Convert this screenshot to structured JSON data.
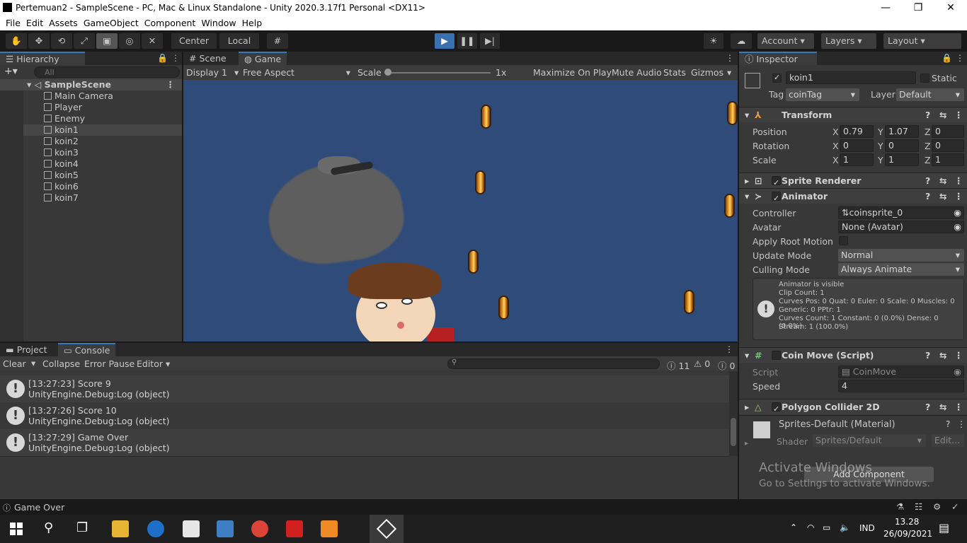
{
  "window": {
    "title": "Pertemuan2 - SampleScene - PC, Mac & Linux Standalone - Unity 2020.3.17f1 Personal <DX11>",
    "minimize": "—",
    "maximize": "❐",
    "close": "✕"
  },
  "menu": [
    "File",
    "Edit",
    "Assets",
    "GameObject",
    "Component",
    "Window",
    "Help"
  ],
  "toolbar": {
    "center_label": "Center",
    "local_label": "Local",
    "account_label": "Account",
    "layers_label": "Layers",
    "layout_label": "Layout"
  },
  "hierarchy": {
    "tab_label": "Hierarchy",
    "search_placeholder": "All",
    "scene_name": "SampleScene",
    "items": [
      "Main Camera",
      "Player",
      "Enemy",
      "koin1",
      "koin2",
      "koin3",
      "koin4",
      "koin5",
      "koin6",
      "koin7"
    ]
  },
  "game": {
    "tabs": [
      "Scene",
      "Game"
    ],
    "display": "Display 1",
    "aspect": "Free Aspect",
    "scale_label": "Scale",
    "scale_value": "1x",
    "maximize_on_play": "Maximize On Play",
    "mute_audio": "Mute Audio",
    "stats": "Stats",
    "gizmos": "Gizmos"
  },
  "console": {
    "tabs": [
      "Project",
      "Console"
    ],
    "clear": "Clear",
    "collapse": "Collapse",
    "error_pause": "Error Pause",
    "editor": "Editor",
    "count_log": "11",
    "count_warn": "0",
    "count_error": "0",
    "entries": [
      {
        "line1": "[13:27:23] Score 9",
        "line2": "UnityEngine.Debug:Log (object)"
      },
      {
        "line1": "[13:27:26] Score 10",
        "line2": "UnityEngine.Debug:Log (object)"
      },
      {
        "line1": "[13:27:29] Game Over",
        "line2": "UnityEngine.Debug:Log (object)"
      }
    ]
  },
  "inspector": {
    "tab_label": "Inspector",
    "object_name": "koin1",
    "static_label": "Static",
    "tag_label": "Tag",
    "tag_value": "coinTag",
    "layer_label": "Layer",
    "layer_value": "Default",
    "transform": {
      "title": "Transform",
      "position_label": "Position",
      "pos_x": "0.79",
      "pos_y": "1.07",
      "pos_z": "0",
      "rotation_label": "Rotation",
      "rot_x": "0",
      "rot_y": "0",
      "rot_z": "0",
      "scale_label": "Scale",
      "scl_x": "1",
      "scl_y": "1",
      "scl_z": "1"
    },
    "sprite_renderer_title": "Sprite Renderer",
    "animator": {
      "title": "Animator",
      "controller_label": "Controller",
      "controller_value": "coinsprite_0",
      "avatar_label": "Avatar",
      "avatar_value": "None (Avatar)",
      "apply_root_label": "Apply Root Motion",
      "update_mode_label": "Update Mode",
      "update_mode_value": "Normal",
      "culling_label": "Culling Mode",
      "culling_value": "Always Animate",
      "info": [
        "Animator is visible",
        "Clip Count: 1",
        "Curves Pos: 0 Quat: 0 Euler: 0 Scale: 0 Muscles: 0",
        "Generic: 0 PPtr: 1",
        "Curves Count: 1 Constant: 0 (0.0%) Dense: 0 (0.0%)",
        "Stream: 1 (100.0%)"
      ]
    },
    "coin_move": {
      "title": "Coin Move (Script)",
      "script_label": "Script",
      "script_value": "CoinMove",
      "speed_label": "Speed",
      "speed_value": "4"
    },
    "polygon_title": "Polygon Collider 2D",
    "material": {
      "name": "Sprites-Default (Material)",
      "shader_label": "Shader",
      "shader_value": "Sprites/Default",
      "edit_label": "Edit..."
    },
    "add_component": "Add Component",
    "activate_line1": "Activate Windows",
    "activate_line2": "Go to Settings to activate Windows."
  },
  "status_bar": {
    "message": "Game Over"
  },
  "taskbar": {
    "lang": "IND",
    "time": "13.28",
    "date": "26/09/2021"
  }
}
